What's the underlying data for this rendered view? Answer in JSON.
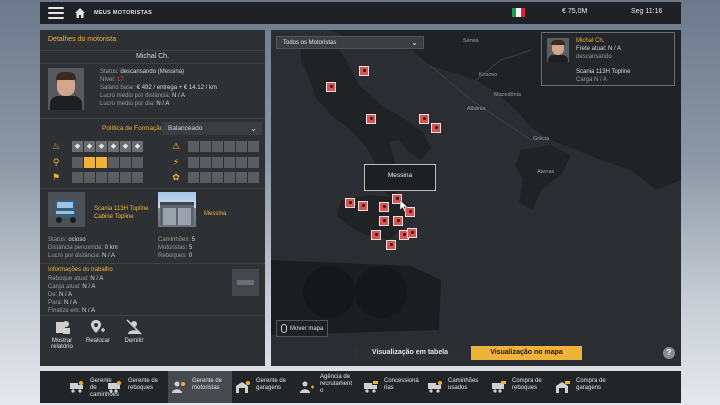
{
  "topbar": {
    "breadcrumb": "MEUS MOTORISTAS",
    "money": "€ 75,0M",
    "clock": "Seg 11:16",
    "flag_colors": [
      "#1e9d47",
      "#f5f5f5",
      "#d5263a"
    ]
  },
  "driver": {
    "panel_title": "Detalhes do motorista",
    "name": "Michal Ch.",
    "status_label": "Status:",
    "status_value": "descansando (Messina)",
    "level_label": "Nível:",
    "level_value": "17",
    "salary_label": "Salário base:",
    "salary_value": "€ 492 / entrega + € 14.12 / km",
    "profit_distance_label": "Lucro médio por distância:",
    "profit_distance_value": "N / A",
    "profit_day_label": "Lucro médio por dia:",
    "profit_day_value": "N / A",
    "policy_label": "Política de Formação:",
    "policy_value": "Balanceado"
  },
  "truck": {
    "name_line1": "Scania 113H Topline",
    "name_line2": "Cabine Topline",
    "status_label": "Status:",
    "status_value": "ocioso",
    "distance_label": "Distância percorrida:",
    "distance_value": "0 km",
    "profit_label": "Lucro por distância:",
    "profit_value": "N / A"
  },
  "garage": {
    "name": "Messina",
    "trucks_label": "Caminhões:",
    "trucks_value": "5",
    "drivers_label": "Motoristas:",
    "drivers_value": "5",
    "trailers_label": "Reboques:",
    "trailers_value": "0"
  },
  "work": {
    "title": "Informações do trabalho",
    "trailer_label": "Reboque atual:",
    "trailer_value": "N / A",
    "cargo_label": "Carga atual:",
    "cargo_value": "N / A",
    "from_label": "De:",
    "from_value": "N / A",
    "to_label": "Para:",
    "to_value": "N / A",
    "finish_label": "Finalize em:",
    "finish_value": "N / A"
  },
  "actions": {
    "report_line1": "Mostrar",
    "report_line2": "relatório",
    "relocate": "Realocar",
    "fire": "Demitir"
  },
  "map": {
    "filter": "Todos os Motoristas",
    "tooltip": "Messina",
    "cities": {
      "serbia": "Sérvia",
      "kosovo": "Kosovo",
      "macedonia": "Macedônia",
      "albania": "Albânia",
      "greece": "Grécia",
      "athens": "Atenas"
    },
    "move_map": "Mover mapa",
    "table_view": "Visualização em tabela",
    "map_view": "Visualização no mapa"
  },
  "mini_card": {
    "name": "Michal Ch.",
    "freight": "Frete atual: N / A",
    "status": "descansando",
    "truck": "Scania 113H Topline",
    "cargo": "Carga N / A"
  },
  "bottombar": {
    "items": [
      {
        "l1": "Gerente de",
        "l2": "caminhões",
        "l3": ""
      },
      {
        "l1": "Gerente de",
        "l2": "reboques",
        "l3": ""
      },
      {
        "l1": "Gerente de",
        "l2": "motoristas",
        "l3": ""
      },
      {
        "l1": "Gerente de",
        "l2": "garagens",
        "l3": ""
      },
      {
        "l1": "Agência de",
        "l2": "recrutament",
        "l3": "o"
      },
      {
        "l1": "Concessioná",
        "l2": "rias",
        "l3": ""
      },
      {
        "l1": "Caminhões",
        "l2": "usados",
        "l3": ""
      },
      {
        "l1": "Compra de",
        "l2": "reboques",
        "l3": ""
      },
      {
        "l1": "Compra de",
        "l2": "garagens",
        "l3": ""
      }
    ]
  },
  "colors": {
    "accent": "#f0b33a",
    "panel": "#2e3134",
    "marker": "#d75454",
    "level": "#e04646"
  }
}
